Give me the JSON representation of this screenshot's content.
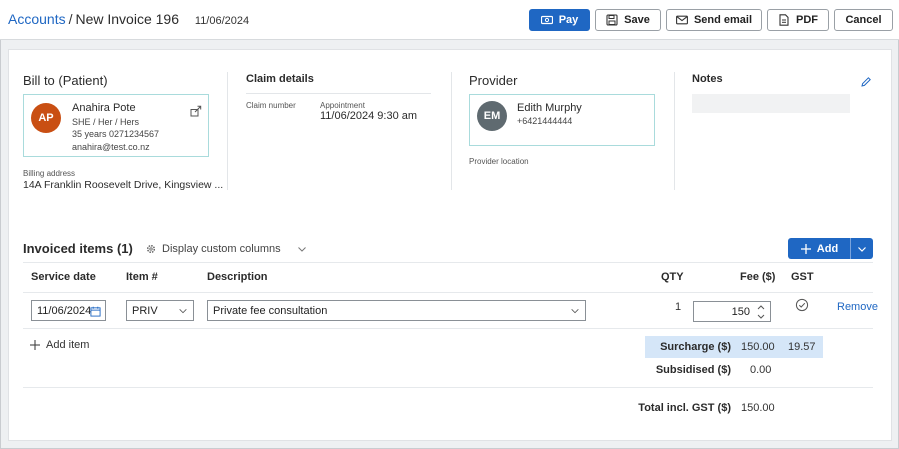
{
  "header": {
    "breadcrumb_link": "Accounts",
    "separator": "/",
    "title": "New Invoice 196",
    "date": "11/06/2024",
    "buttons": {
      "pay": "Pay",
      "save": "Save",
      "send_email": "Send email",
      "pdf": "PDF",
      "cancel": "Cancel"
    }
  },
  "bill_to": {
    "title": "Bill to (Patient)",
    "initials": "AP",
    "avatar_color": "#c94f13",
    "name": "Anahira Pote",
    "pronouns": "SHE / Her / Hers",
    "age": "35 years",
    "phone": "0271234567",
    "email": "anahira@test.co.nz",
    "billing_address_label": "Billing address",
    "billing_address": "14A Franklin Roosevelt Drive, Kingsview ..."
  },
  "claim": {
    "title": "Claim details",
    "claim_number_label": "Claim number",
    "appointment_label": "Appointment",
    "appointment_value": "11/06/2024 9:30 am"
  },
  "provider": {
    "title": "Provider",
    "initials": "EM",
    "avatar_color": "#5f6a70",
    "name": "Edith Murphy",
    "phone": "+6421444444",
    "location_label": "Provider location"
  },
  "notes": {
    "title": "Notes"
  },
  "items": {
    "title_prefix": "Invoiced items",
    "count": "(1)",
    "display_custom_columns": "Display custom columns",
    "add_label": "Add",
    "columns": {
      "service_date": "Service date",
      "item_no": "Item #",
      "description": "Description",
      "qty": "QTY",
      "fee": "Fee ($)",
      "gst": "GST"
    },
    "rows": [
      {
        "service_date": "11/06/2024",
        "item_no": "PRIV",
        "description": "Private fee consultation",
        "qty": "1",
        "fee": "150",
        "remove": "Remove"
      }
    ],
    "add_item": "Add item"
  },
  "totals": {
    "surcharge_label": "Surcharge ($)",
    "surcharge_value": "150.00",
    "surcharge_gst": "19.57",
    "subsidised_label": "Subsidised ($)",
    "subsidised_value": "0.00",
    "total_label": "Total incl. GST ($)",
    "total_value": "150.00"
  },
  "colors": {
    "primary": "#1f67c3",
    "highlight": "#d5e6f8",
    "patient_border": "#a9dbdc"
  }
}
